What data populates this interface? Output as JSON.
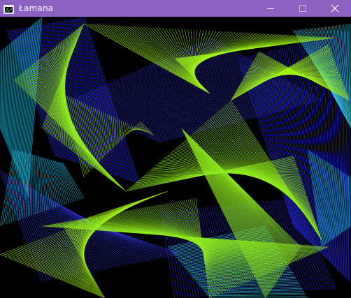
{
  "window": {
    "title": "Łamana",
    "icon": "window-app-icon",
    "controls": {
      "minimize": "minimize-icon",
      "maximize": "maximize-icon",
      "close": "close-icon"
    }
  },
  "canvas": {
    "background": "#000000",
    "palette": [
      "#2b2cf2",
      "#3437f8",
      "#1fb8dc",
      "#36d6f0",
      "#8fea1e",
      "#a2f516"
    ]
  },
  "colors": {
    "titlebar": "#8b62c1",
    "titlebar_text": "#ffffff"
  }
}
